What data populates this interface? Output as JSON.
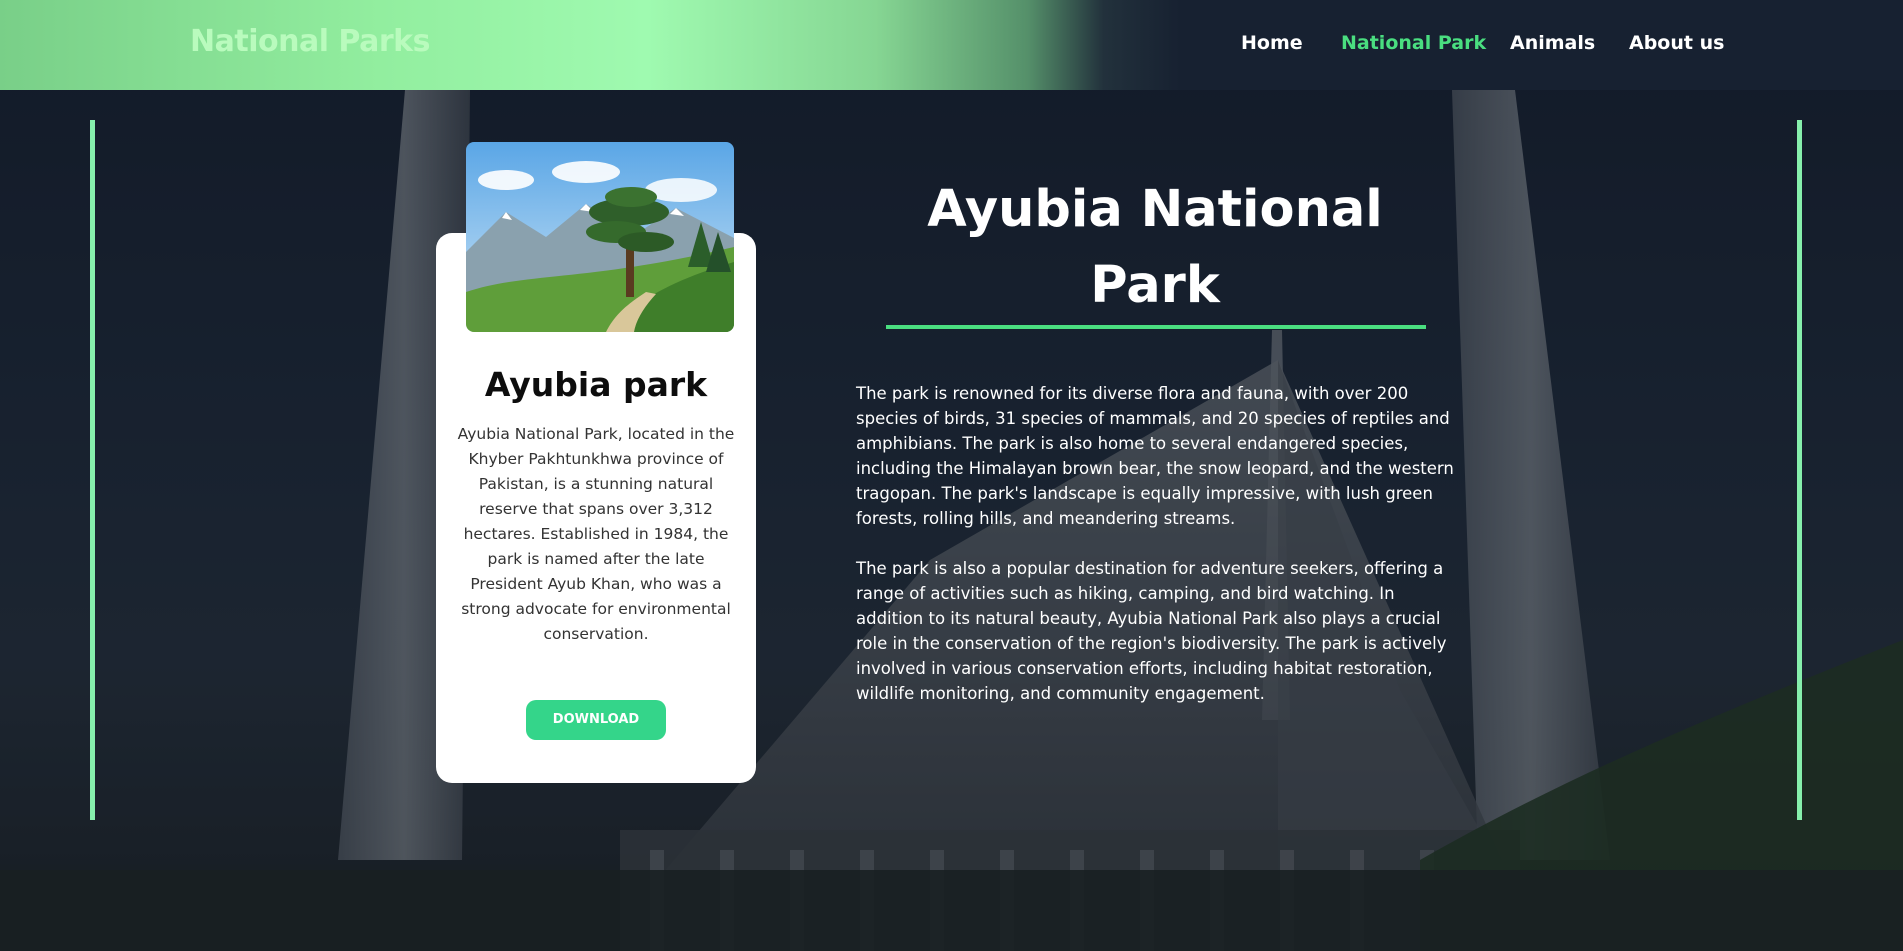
{
  "header": {
    "brand": "National Parks",
    "nav": [
      {
        "label": "Home",
        "active": false
      },
      {
        "label": "National Park",
        "active": true
      },
      {
        "label": "Animals",
        "active": false
      },
      {
        "label": "About us",
        "active": false
      }
    ]
  },
  "card": {
    "image_icon": "landscape-image",
    "title": "Ayubia park",
    "text": "Ayubia National Park, located in the Khyber Pakhtunkhwa province of Pakistan, is a stunning natural reserve that spans over 3,312 hectares. Established in 1984, the park is named after the late President Ayub Khan, who was a strong advocate for environmental conservation.",
    "button_label": "DOWNLOAD"
  },
  "main": {
    "title": "Ayubia National Park",
    "paragraphs": [
      "The park is renowned for its diverse flora and fauna, with over 200 species of birds, 31 species of mammals, and 20 species of reptiles and amphibians. The park is also home to several endangered species, including the Himalayan brown bear, the snow leopard, and the western tragopan. The park's landscape is equally impressive, with lush green forests, rolling hills, and meandering streams.",
      "The park is also a popular destination for adventure seekers, offering a range of activities such as hiking, camping, and bird watching. In addition to its natural beauty, Ayubia National Park also plays a crucial role in the conservation of the region's biodiversity. The park is actively involved in various conservation efforts, including habitat restoration, wildlife monitoring, and community engagement."
    ]
  },
  "colors": {
    "accent": "#4ade80",
    "button": "#34d58a",
    "side_bars": "#86efac",
    "header_dark": "#172131"
  }
}
